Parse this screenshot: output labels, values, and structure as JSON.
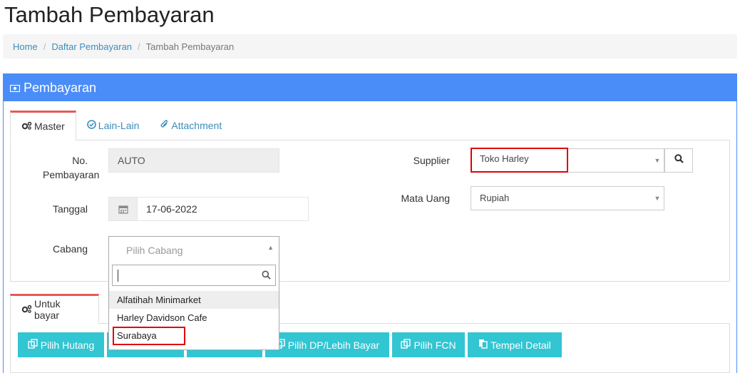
{
  "page": {
    "title": "Tambah Pembayaran"
  },
  "breadcrumb": {
    "home": "Home",
    "list": "Daftar Pembayaran",
    "current": "Tambah Pembayaran",
    "separator": "/"
  },
  "panel": {
    "title": "Pembayaran"
  },
  "tabs": {
    "master": "Master",
    "lain": "Lain-Lain",
    "attachment": "Attachment"
  },
  "form": {
    "no_label_1": "No.",
    "no_label_2": "Pembayaran",
    "no_value": "AUTO",
    "tanggal_label": "Tanggal",
    "tanggal_value": "17-06-2022",
    "cabang_label": "Cabang",
    "supplier_label": "Supplier",
    "supplier_value": "Toko Harley",
    "mata_uang_label": "Mata Uang",
    "mata_uang_value": "Rupiah"
  },
  "cabang_dropdown": {
    "placeholder": "Pilih Cabang",
    "search_value": "",
    "options": [
      "Alfatihah Minimarket",
      "Harley Davidson Cafe",
      "Surabaya"
    ]
  },
  "bottom_tabs": {
    "untuk_bayar": "Untuk bayar"
  },
  "buttons": {
    "pilih_hutang": "Pilih Hutang",
    "pilih_dp": "Pilih DP/Lebih Bayar",
    "pilih_fcn": "Pilih FCN",
    "tempel_detail": "Tempel Detail"
  },
  "colors": {
    "primary": "#4b8df8",
    "button": "#32c5d2",
    "highlight_border": "#e00000",
    "tab_accent": "#e35b5a"
  }
}
